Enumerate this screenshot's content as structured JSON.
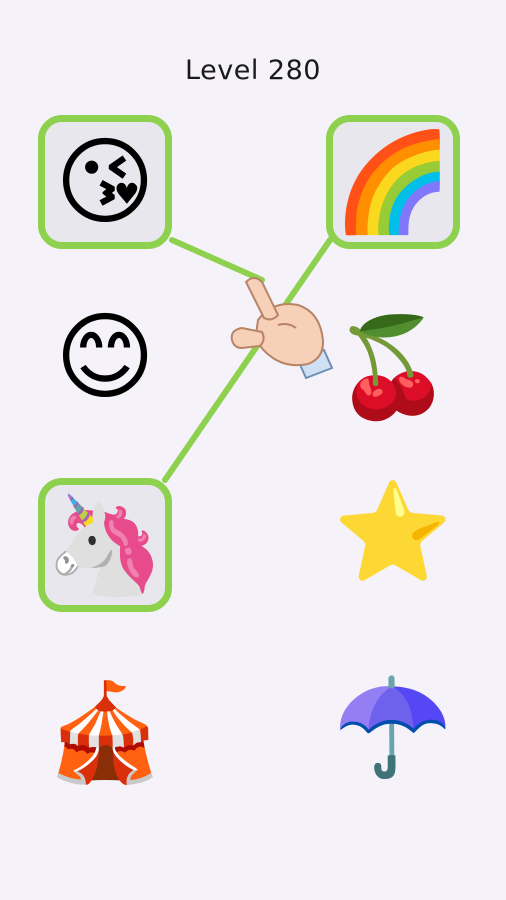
{
  "level_title": "Level 280",
  "colors": {
    "accent": "#8ed14f",
    "tile_selected_bg": "#e9e7ee",
    "background": "#f5f2f9"
  },
  "left_column": [
    {
      "name": "kissing-winking-face",
      "emoji": "😘",
      "selected": true
    },
    {
      "name": "smiling-face",
      "emoji": "😊",
      "selected": false
    },
    {
      "name": "unicorn",
      "emoji": "🦄",
      "selected": true
    },
    {
      "name": "circus-tent",
      "emoji": "🎪",
      "selected": false
    }
  ],
  "right_column": [
    {
      "name": "rainbow",
      "emoji": "🌈",
      "selected": true
    },
    {
      "name": "cherries",
      "emoji": "🍒",
      "selected": false
    },
    {
      "name": "star",
      "emoji": "⭐",
      "selected": false
    },
    {
      "name": "umbrella",
      "emoji": "☂️",
      "selected": false
    }
  ],
  "connections": [
    {
      "from": "kissing-winking-face",
      "to": "pointer-hand"
    },
    {
      "from": "rainbow",
      "to": "unicorn"
    }
  ],
  "hand_icon": "pointing-hand-icon"
}
